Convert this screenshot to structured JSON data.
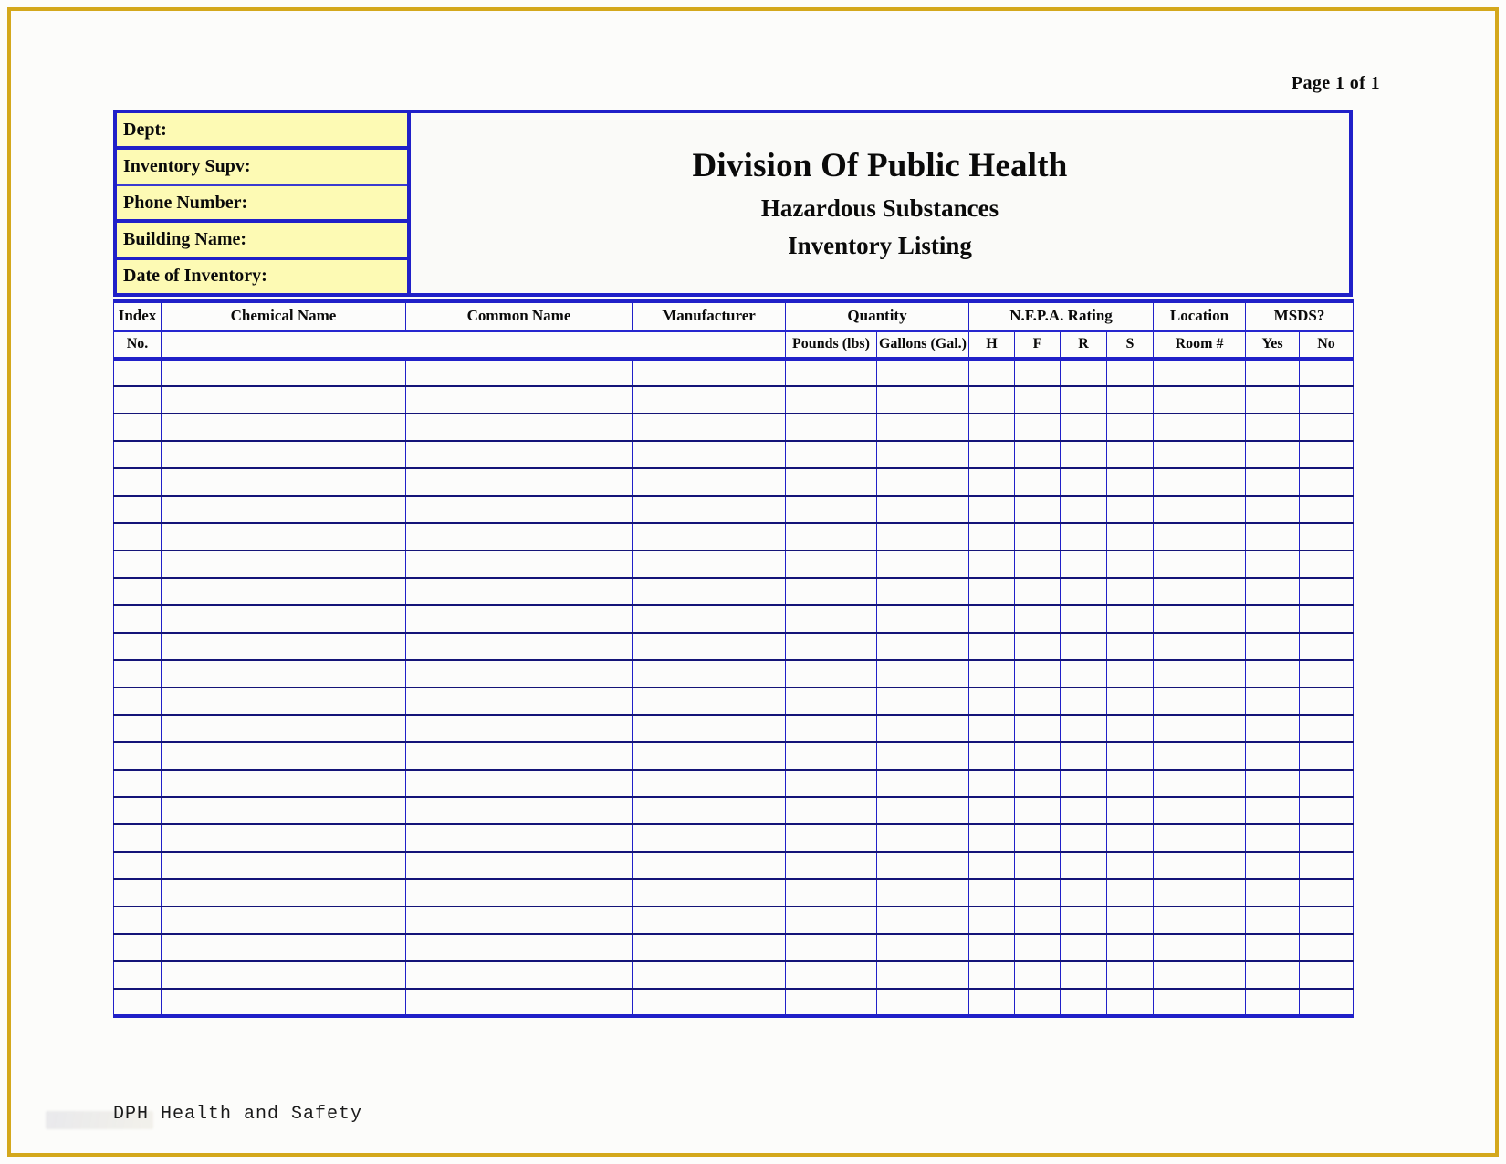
{
  "page": {
    "page_label": "Page 1 of  1",
    "frame_color": "#d4a81c",
    "grid_color": "#2020c8",
    "field_fill_color": "#fdfab4"
  },
  "header": {
    "fields": [
      {
        "label": "Dept:",
        "value": ""
      },
      {
        "label": "Inventory  Supv:",
        "value": ""
      },
      {
        "label": "Phone Number:",
        "value": ""
      },
      {
        "label": "Building Name:",
        "value": ""
      },
      {
        "label": "Date of Inventory:",
        "value": ""
      }
    ],
    "title_main": "Division Of Public Health",
    "title_sub1": "Hazardous Substances",
    "title_sub2": "Inventory Listing"
  },
  "table": {
    "group_headers": {
      "index": "Index",
      "chemical_name": "Chemical Name",
      "common_name": "Common Name",
      "manufacturer": "Manufacturer",
      "quantity": "Quantity",
      "nfpa": "N.F.P.A. Rating",
      "location": "Location",
      "msds": "MSDS?"
    },
    "sub_headers": {
      "index_no": "No.",
      "pounds": "Pounds (lbs)",
      "gallons": "Gallons (Gal.)",
      "nfpa_h": "H",
      "nfpa_f": "F",
      "nfpa_r": "R",
      "nfpa_s": "S",
      "room": "Room #",
      "yes": "Yes",
      "no": "No"
    },
    "row_count": 24,
    "rows": []
  },
  "footer": {
    "text": "DPH Health and Safety"
  }
}
